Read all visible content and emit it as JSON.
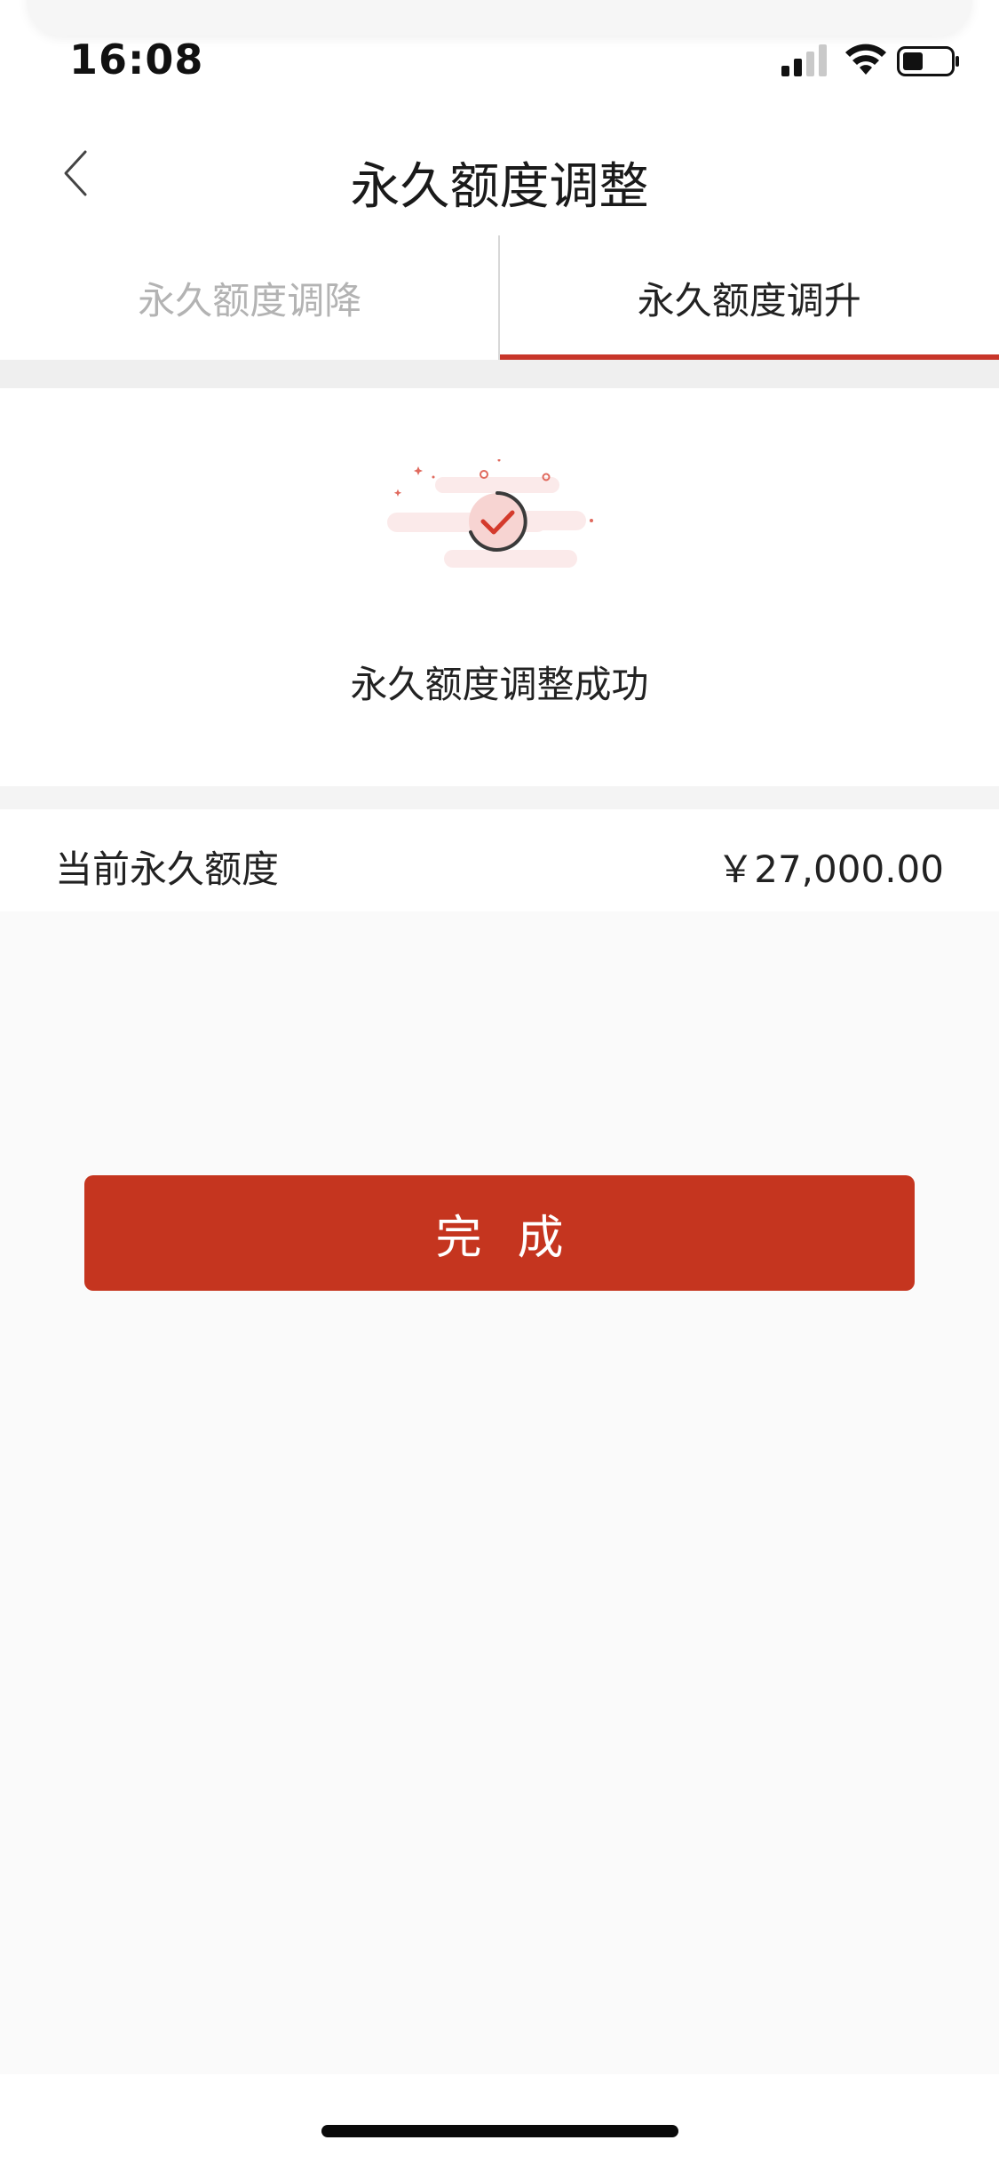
{
  "status_bar": {
    "time": "16:08"
  },
  "header": {
    "title": "永久额度调整",
    "back_icon": "chevron-left-icon"
  },
  "tabs": [
    {
      "label": "永久额度调降",
      "active": false
    },
    {
      "label": "永久额度调升",
      "active": true
    }
  ],
  "success": {
    "icon": "success-check-icon",
    "message": "永久额度调整成功"
  },
  "limit": {
    "label": "当前永久额度",
    "value": "￥27,000.00"
  },
  "actions": {
    "done_label": "完成"
  },
  "colors": {
    "accent": "#c5351f",
    "tab_underline": "#c8362a",
    "inactive_text": "#b3b3b3",
    "background": "#fafafa"
  }
}
